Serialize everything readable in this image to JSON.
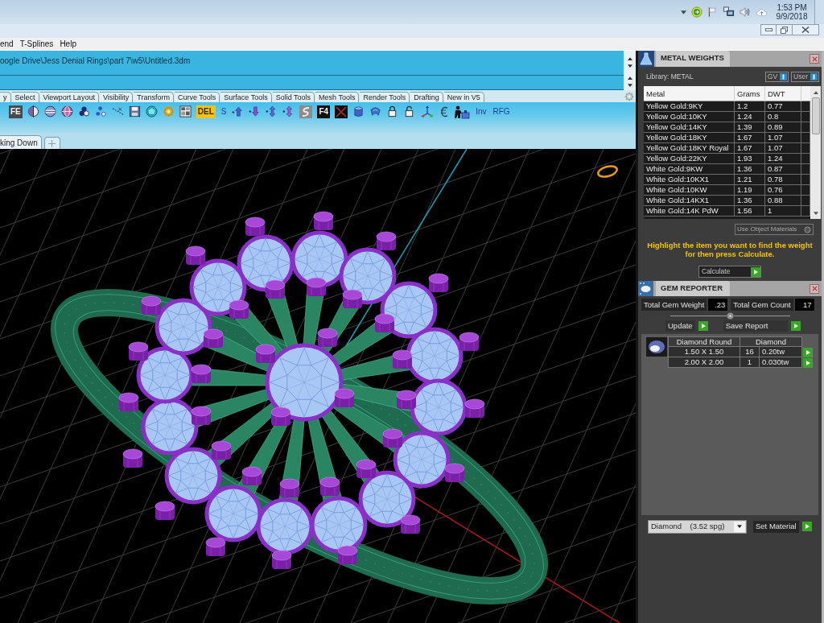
{
  "taskbar": {
    "time": "1:53 PM",
    "date": "9/9/2018"
  },
  "menu": [
    "end",
    "T-Splines",
    "Help"
  ],
  "command_history": [
    "oogle Drive\\Jess Denial Rings\\part 7\\w5\\Untitled.3dm"
  ],
  "toolbar_tabs": [
    {
      "label": "y",
      "selected": false
    },
    {
      "label": "Select",
      "selected": false
    },
    {
      "label": "Viewport Layout",
      "selected": false
    },
    {
      "label": "Visibility",
      "selected": false
    },
    {
      "label": "Transform",
      "selected": false
    },
    {
      "label": "Curve Tools",
      "selected": false
    },
    {
      "label": "Surface Tools",
      "selected": false
    },
    {
      "label": "Solid Tools",
      "selected": false
    },
    {
      "label": "Mesh Tools",
      "selected": false
    },
    {
      "label": "Render Tools",
      "selected": false
    },
    {
      "label": "Drafting",
      "selected": false
    },
    {
      "label": "New in V5",
      "selected": false
    }
  ],
  "toolbar": [
    {
      "kind": "tile",
      "label": "FE",
      "color": "#4a4a4a"
    },
    {
      "kind": "icon"
    },
    {
      "kind": "icon"
    },
    {
      "kind": "icon"
    },
    {
      "kind": "icon"
    },
    {
      "kind": "icon"
    },
    {
      "kind": "icon"
    },
    {
      "kind": "icon"
    },
    {
      "kind": "icon"
    },
    {
      "kind": "icon"
    },
    {
      "kind": "icon"
    },
    {
      "kind": "tile",
      "label": "DEL",
      "color": "#f2c21b"
    },
    {
      "kind": "text",
      "label": "S"
    },
    {
      "kind": "icon"
    },
    {
      "kind": "icon"
    },
    {
      "kind": "icon"
    },
    {
      "kind": "icon"
    },
    {
      "kind": "icon"
    },
    {
      "kind": "tile",
      "label": "F4",
      "color": "#111111"
    },
    {
      "kind": "icon"
    },
    {
      "kind": "icon"
    },
    {
      "kind": "icon"
    },
    {
      "kind": "icon"
    },
    {
      "kind": "icon"
    },
    {
      "kind": "icon"
    },
    {
      "kind": "icon"
    },
    {
      "kind": "icon"
    },
    {
      "kind": "text",
      "label": "Inv"
    },
    {
      "kind": "text",
      "label": "RFG"
    }
  ],
  "viewport_tabs": [
    {
      "label": "king Down",
      "selected": true
    }
  ],
  "metal_weights": {
    "title": "METAL WEIGHTS",
    "library": "Library: METAL",
    "toggles": [
      {
        "label": "GV",
        "on": true
      },
      {
        "label": "User",
        "on": true
      }
    ],
    "columns": [
      "Metal",
      "Grams",
      "DWT"
    ],
    "rows": [
      {
        "metal": "Yellow Gold:9KY",
        "grams": "1.2",
        "dwt": "0.77",
        "selected": false
      },
      {
        "metal": "Yellow Gold:10KY",
        "grams": "1.24",
        "dwt": "0.8",
        "selected": false
      },
      {
        "metal": "Yellow Gold:14KY",
        "grams": "1.39",
        "dwt": "0.89",
        "selected": false
      },
      {
        "metal": "Yellow Gold:18KY",
        "grams": "1.67",
        "dwt": "1.07",
        "selected": false
      },
      {
        "metal": "Yellow Gold:18KY Royal",
        "grams": "1.67",
        "dwt": "1.07",
        "selected": false
      },
      {
        "metal": "Yellow Gold:22KY",
        "grams": "1.93",
        "dwt": "1.24",
        "selected": false
      },
      {
        "metal": "White Gold:9KW",
        "grams": "1.36",
        "dwt": "0.87",
        "selected": false
      },
      {
        "metal": "White Gold:10KX1",
        "grams": "1.21",
        "dwt": "0.78",
        "selected": false
      },
      {
        "metal": "White Gold:10KW",
        "grams": "1.19",
        "dwt": "0.76",
        "selected": false
      },
      {
        "metal": "White Gold:14KX1",
        "grams": "1.36",
        "dwt": "0.88",
        "selected": false
      },
      {
        "metal": "White Gold:14K PdW",
        "grams": "1.56",
        "dwt": "1",
        "selected": false
      }
    ],
    "use_object_materials": "Use Object Materials",
    "hint": "Highlight the item you want to find the weight for then press Calculate.",
    "calculate": "Calculate"
  },
  "gem_reporter": {
    "title": "GEM REPORTER",
    "stats": [
      {
        "label": "Total Gem Weight",
        "value": ".23"
      },
      {
        "label": "Total Gem Count",
        "value": "17"
      }
    ],
    "buttons": [
      "Update",
      "Save Report"
    ],
    "table": {
      "columns": [
        "Diamond Round",
        "Diamond"
      ],
      "rows": [
        {
          "size": "1.50 X 1.50",
          "count": "16",
          "weight": "0.20tw"
        },
        {
          "size": "2.00 X 2.00",
          "count": "1",
          "weight": "0.030tw"
        }
      ]
    },
    "material": "Diamond    (3.52 spg)",
    "set_material": "Set Material"
  }
}
